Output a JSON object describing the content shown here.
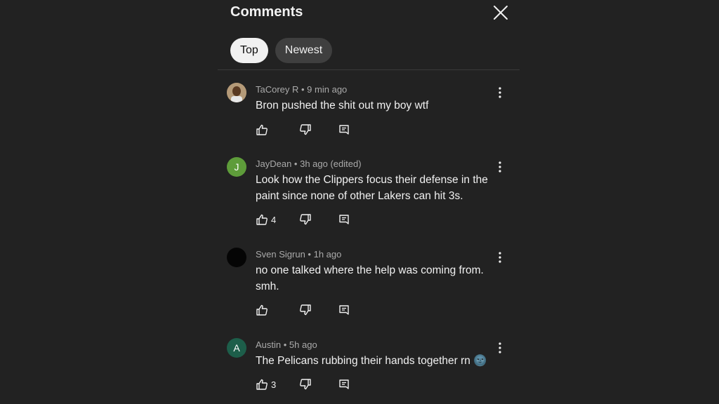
{
  "header": {
    "title": "Comments"
  },
  "tabs": [
    {
      "label": "Top",
      "active": true
    },
    {
      "label": "Newest",
      "active": false
    }
  ],
  "comments": [
    {
      "author": "TaCorey R",
      "meta": "TaCorey R • 9 min ago",
      "text": "Bron pushed the shit out my boy wtf",
      "likes": "",
      "avatar": {
        "type": "photo",
        "letter": "",
        "color": "#8a6a48"
      }
    },
    {
      "author": "JayDean",
      "meta": "JayDean • 3h ago (edited)",
      "text": "Look how the Clippers focus their defense in the paint since none of other Lakers can hit 3s.",
      "likes": "4",
      "avatar": {
        "type": "letter",
        "letter": "J",
        "color": "#5e9c3a"
      }
    },
    {
      "author": "Sven Sigrun",
      "meta": "Sven Sigrun • 1h ago",
      "text": "no one talked where the help was coming from. smh.",
      "likes": "",
      "avatar": {
        "type": "dark",
        "letter": "",
        "color": "#050505"
      }
    },
    {
      "author": "Austin",
      "meta": "Austin  • 5h ago",
      "text": "The Pelicans rubbing their hands together rn 🌚",
      "likes": "3",
      "avatar": {
        "type": "letter",
        "letter": "A",
        "color": "#1d5e4a"
      }
    }
  ],
  "colors": {
    "background": "#222222",
    "text_primary": "#f1f1f1",
    "text_secondary": "#aaaaaa",
    "chip_active_bg": "#f1f1f1",
    "chip_inactive_bg": "#3f3f3f"
  },
  "icons": [
    "close-icon",
    "more-vert-icon",
    "thumbs-up-icon",
    "thumbs-down-icon",
    "reply-icon"
  ]
}
